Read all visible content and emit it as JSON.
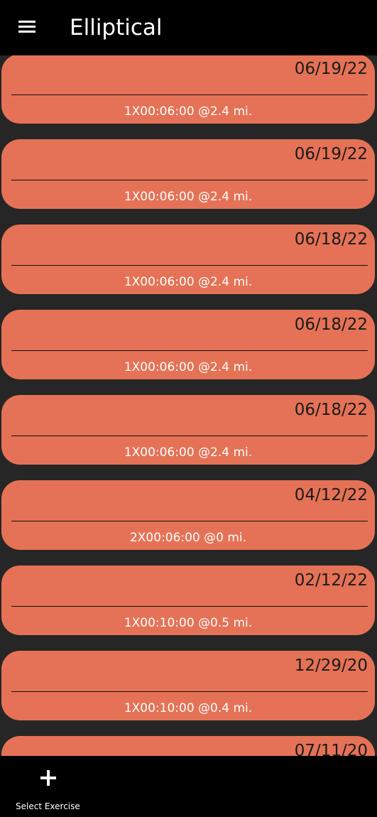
{
  "header": {
    "title": "Elliptical",
    "menu_icon": "hamburger-menu-icon"
  },
  "entries": [
    {
      "date": "06/19/22",
      "summary": "1X00:06:00 @2.4 mi."
    },
    {
      "date": "06/19/22",
      "summary": "1X00:06:00 @2.4 mi."
    },
    {
      "date": "06/18/22",
      "summary": "1X00:06:00 @2.4 mi."
    },
    {
      "date": "06/18/22",
      "summary": "1X00:06:00 @2.4 mi."
    },
    {
      "date": "06/18/22",
      "summary": "1X00:06:00 @2.4 mi."
    },
    {
      "date": "04/12/22",
      "summary": "2X00:06:00 @0 mi."
    },
    {
      "date": "02/12/22",
      "summary": "1X00:10:00 @0.5 mi."
    },
    {
      "date": "12/29/20",
      "summary": "1X00:10:00 @0.4 mi."
    },
    {
      "date": "07/11/20",
      "summary": ""
    }
  ],
  "bottom_bar": {
    "add_label": "Select Exercise",
    "add_icon": "plus-icon"
  },
  "colors": {
    "card": "#e57256",
    "background": "#262626",
    "bars": "#000000"
  }
}
